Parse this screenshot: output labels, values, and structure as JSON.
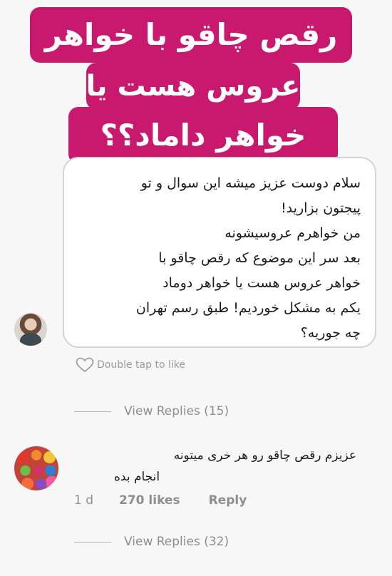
{
  "banner": {
    "line1": "رقص چاقو با خواهر",
    "line2": "عروس هست یا",
    "line3": "خواهر داماد؟؟"
  },
  "comment1": {
    "lines": [
      "سلام دوست عزیز میشه این سوال و تو",
      "پیجتون بزارید!",
      "من خواهرم عروسیشونه",
      "بعد سر این موضوع که رقص چاقو با",
      "خواهر عروس هست یا خواهر دوماد",
      "یکم به مشکل خوردیم! طبق رسم تهران",
      "چه جوریه؟"
    ],
    "like_prompt": "Double tap to like",
    "view_replies": "View Replies (15)"
  },
  "comment2": {
    "line1": "عزیزم رقص چاقو رو هر خری میتونه",
    "line2": "انجام بده",
    "time": "1 d",
    "likes": "270 likes",
    "reply": "Reply",
    "view_replies": "View Replies (32)"
  },
  "colors": {
    "banner": "#c8196e",
    "muted_text": "#8e8e8e"
  },
  "icons": {
    "like": "heart-icon"
  }
}
